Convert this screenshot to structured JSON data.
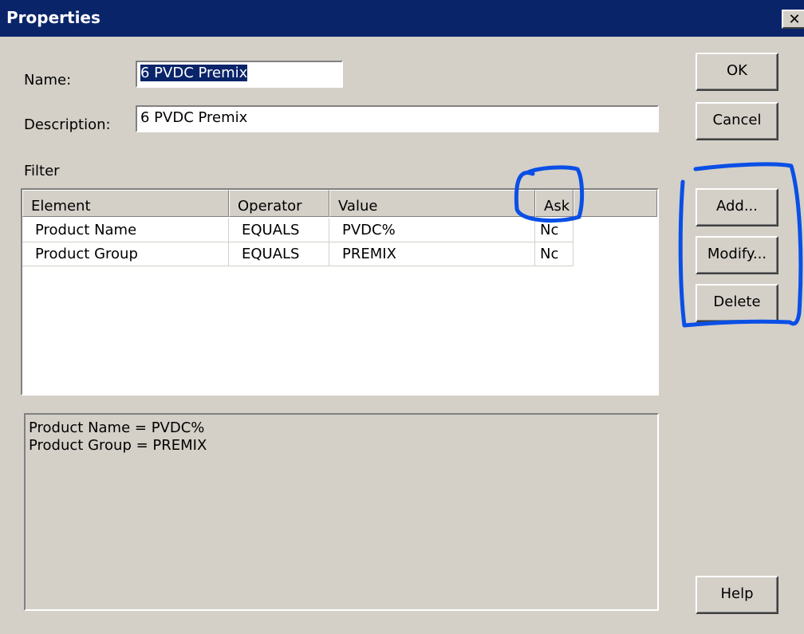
{
  "window": {
    "title": "Properties",
    "close_glyph": "✕"
  },
  "form": {
    "name_label": "Name:",
    "name_value": "6 PVDC Premix",
    "description_label": "Description:",
    "description_value": "6 PVDC Premix",
    "filter_label": "Filter"
  },
  "buttons": {
    "ok": "OK",
    "cancel": "Cancel",
    "add": "Add...",
    "modify": "Modify...",
    "delete": "Delete",
    "help": "Help"
  },
  "filter_table": {
    "columns": [
      "Element",
      "Operator",
      "Value",
      "Ask"
    ],
    "rows": [
      [
        "Product Name",
        "EQUALS",
        "PVDC%",
        "Nc"
      ],
      [
        "Product Group",
        "EQUALS",
        "PREMIX",
        "Nc"
      ]
    ]
  },
  "summary": {
    "lines": [
      "Product Name = PVDC%",
      "Product Group = PREMIX"
    ]
  },
  "colors": {
    "title_bar": "#0a246a",
    "dialog_face": "#d4d0c8",
    "annotation": "#0a4fe6"
  },
  "icons": {
    "close": "close-icon"
  }
}
